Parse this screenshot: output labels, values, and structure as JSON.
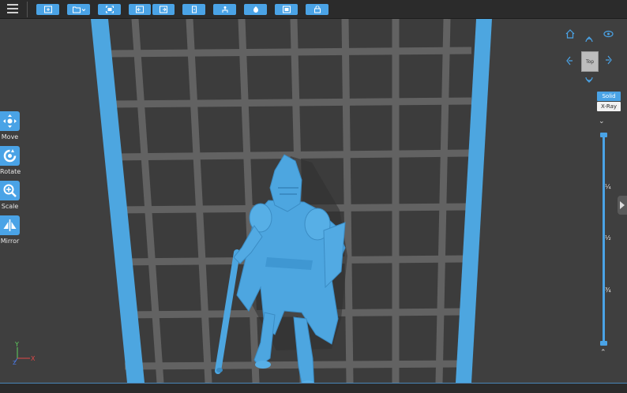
{
  "toolbar": {
    "icons": [
      "menu-icon",
      "open-file-icon",
      "folder-icon",
      "fit-icon",
      "import-icon",
      "export-icon",
      "cut-icon",
      "support-icon",
      "slice-icon",
      "preview-icon",
      "settings-icon"
    ]
  },
  "tools": [
    {
      "label": "Move",
      "icon": "move-icon"
    },
    {
      "label": "Rotate",
      "icon": "rotate-icon"
    },
    {
      "label": "Scale",
      "icon": "scale-icon"
    },
    {
      "label": "Mirror",
      "icon": "mirror-icon"
    }
  ],
  "nav_cube": {
    "face_label": "Top"
  },
  "render_modes": {
    "solid": "Solid",
    "xray": "X-Ray",
    "active": "Solid"
  },
  "layer_slider": {
    "marks": [
      "¼",
      "½",
      "¾"
    ],
    "top_value": 1.0,
    "bottom_value": 0.0
  },
  "axis": {
    "x": "X",
    "y": "Y",
    "z": "Z"
  },
  "colors": {
    "accent": "#4aa3e6",
    "model": "#4da6e0",
    "toolbar_bg": "#2b2b2b",
    "viewport_bg": "#3f3f3f",
    "plate_grid": "#646464"
  }
}
